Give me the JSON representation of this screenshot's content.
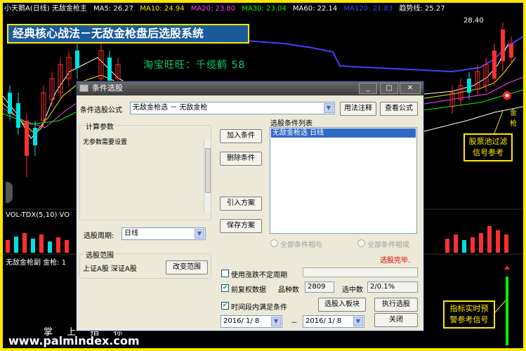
{
  "topbar": {
    "title": "小天鹅A(日线) 无敌金枪主",
    "ma5": "MA5: 26.27",
    "ma10": "MA10: 24.94",
    "ma20": "MA20: 23.80",
    "ma30": "MA30: 23.04",
    "ma60": "MA60: 22.14",
    "ma120": "MA120: 21.83",
    "trend": "趋势线: 25.27"
  },
  "banner": "经典核心战法－无敌金枪盘后选股系统",
  "shop_label": "淘宝旺旺：千缆鹤 58",
  "price_label": "28.40",
  "jinqiang_label": "金枪",
  "vol_label": "VOL-TDX(5,10)  VO",
  "sub_label": "无敌金枪副  金枪: 1",
  "annotation_1": "股票池过滤信号参考",
  "annotation_2": "指标实时预警参考信号",
  "watermark_cn": "掌 上 指 标",
  "watermark_url": "www.palmindex.com",
  "colors": {
    "frame": "#ffe800",
    "ma5": "#ffffff",
    "ma10": "#ffe800",
    "ma20": "#ff40ff",
    "ma30": "#00ff00",
    "ma60": "#ffffff",
    "ma120": "#4040ff",
    "trend": "#ffffff"
  },
  "dialog": {
    "title": "条件选股",
    "formula_label": "条件选股公式",
    "formula_value": "无敌金枪选  － 无敌金枪",
    "usage_button": "用法注释",
    "view_formula_button": "查看公式",
    "calc_params_title": "计算参数",
    "calc_params_text": "无参数需要设置",
    "period_label": "选股周期:",
    "period_value": "日线",
    "add_condition": "加入条件",
    "delete_condition": "删除条件",
    "import_plan": "引入方案",
    "save_plan": "保存方案",
    "condition_list_title": "选股条件列表",
    "condition_list_items": [
      "无敌金枪选  日线"
    ],
    "radio_and": "全部条件相与",
    "radio_or": "全部条件相或",
    "status": "选股完毕.",
    "range_title": "选股范围",
    "range_value": "上证A股 深证A股",
    "change_range": "改变范围",
    "use_variable_period": "使用涨跌不定周期",
    "pre_adjust": "前复权数据",
    "variety_count_label": "品种数",
    "variety_count_value": "2809",
    "selected_count_label": "选中数",
    "selected_count_value": "2/0.1%",
    "within_period": "时间段内满足条件",
    "to_block": "选股入板块",
    "execute": "执行选股",
    "date_from": "2016/ 1/ 8",
    "date_to": "2016/ 1/ 8",
    "date_sep": "－",
    "close": "关闭"
  }
}
